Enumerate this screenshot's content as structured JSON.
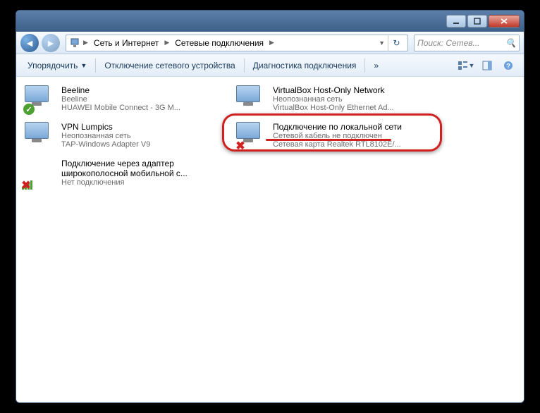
{
  "breadcrumb": {
    "part1": "Сеть и Интернет",
    "part2": "Сетевые подключения"
  },
  "search": {
    "placeholder": "Поиск: Сетев..."
  },
  "toolbar": {
    "organize": "Упорядочить",
    "disable": "Отключение сетевого устройства",
    "diagnose": "Диагностика подключения",
    "more": "»"
  },
  "connections": [
    {
      "name": "Beeline",
      "sub1": "Beeline",
      "sub2": "HUAWEI Mobile Connect - 3G M...",
      "status": "ok"
    },
    {
      "name": "VirtualBox Host-Only Network",
      "sub1": "Неопознанная сеть",
      "sub2": "VirtualBox Host-Only Ethernet Ad...",
      "status": "none"
    },
    {
      "name": "VPN Lumpics",
      "sub1": "Неопознанная сеть",
      "sub2": "TAP-Windows Adapter V9",
      "status": "none"
    },
    {
      "name": "Подключение по локальной сети",
      "sub1": "Сетевой кабель не подключен",
      "sub2": "Сетевая карта Realtek RTL8102E/...",
      "status": "x"
    },
    {
      "name": "Подключение через адаптер широкополосной мобильной с...",
      "sub1": "Нет подключения",
      "sub2": "",
      "status": "signal-x"
    }
  ]
}
